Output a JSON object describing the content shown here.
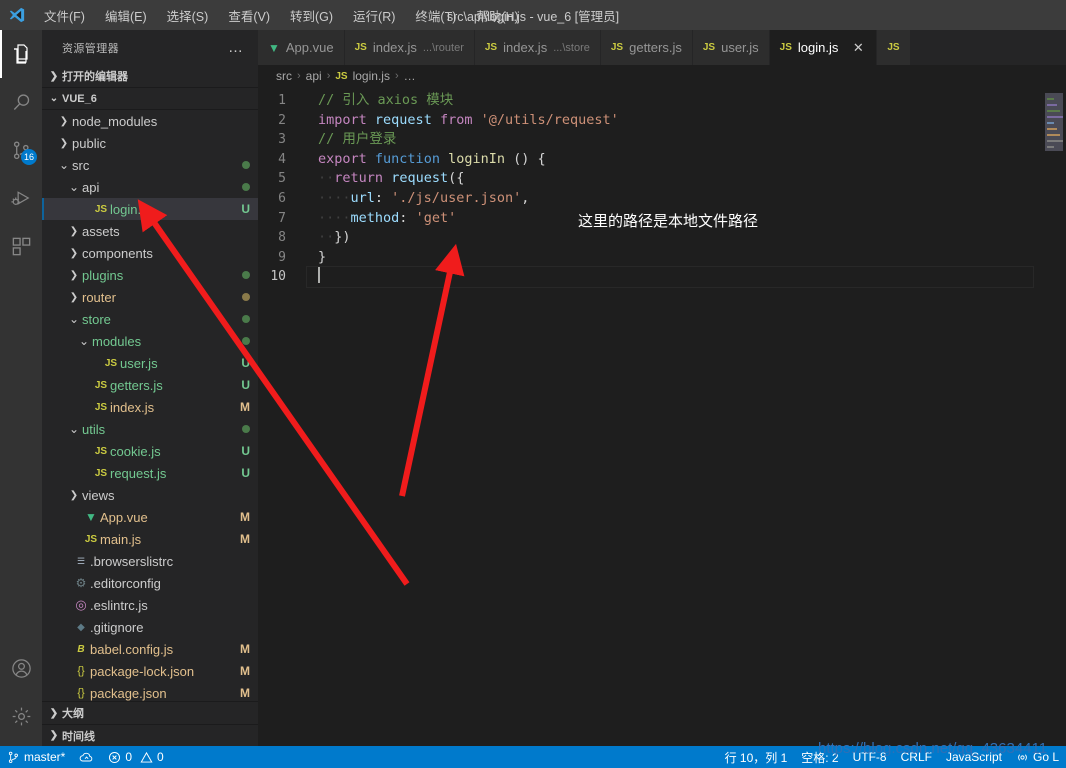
{
  "titlebar": {
    "logo": "vscode-logo-icon",
    "title": "src\\api\\login.js - vue_6 [管理员]",
    "menus": [
      {
        "label": "文件(F)"
      },
      {
        "label": "编辑(E)"
      },
      {
        "label": "选择(S)"
      },
      {
        "label": "查看(V)"
      },
      {
        "label": "转到(G)"
      },
      {
        "label": "运行(R)"
      },
      {
        "label": "终端(T)"
      },
      {
        "label": "帮助(H)"
      }
    ]
  },
  "activitybar": {
    "items": [
      {
        "name": "explorer",
        "icon": "files-icon",
        "active": true,
        "badge": ""
      },
      {
        "name": "search",
        "icon": "search-icon",
        "active": false,
        "badge": ""
      },
      {
        "name": "source-control",
        "icon": "source-control-icon",
        "active": false,
        "badge": "16"
      },
      {
        "name": "run-debug",
        "icon": "run-debug-icon",
        "active": false,
        "badge": ""
      },
      {
        "name": "extensions",
        "icon": "extensions-icon",
        "active": false,
        "badge": ""
      }
    ],
    "bottom": [
      {
        "name": "accounts",
        "icon": "account-icon"
      },
      {
        "name": "settings",
        "icon": "gear-icon"
      }
    ]
  },
  "sidebar": {
    "title": "资源管理器",
    "more_actions": "…",
    "open_editors_label": "打开的编辑器",
    "project_label": "VUE_6",
    "tree": [
      {
        "label": "node_modules",
        "indent": 1,
        "type": "folder",
        "arrow": "right",
        "icon": "",
        "status": "",
        "dot": ""
      },
      {
        "label": "public",
        "indent": 1,
        "type": "folder",
        "arrow": "right",
        "icon": "",
        "status": "",
        "dot": ""
      },
      {
        "label": "src",
        "indent": 1,
        "type": "folder",
        "arrow": "down",
        "icon": "",
        "status": "",
        "dot": "#4a7a4a"
      },
      {
        "label": "api",
        "indent": 2,
        "type": "folder",
        "arrow": "down",
        "icon": "",
        "status": "",
        "dot": "#4a7a4a"
      },
      {
        "label": "login.js",
        "indent": 3,
        "type": "file",
        "arrow": "",
        "icon": "js",
        "status": "U",
        "dot": "",
        "selected": true,
        "color": "#73c991"
      },
      {
        "label": "assets",
        "indent": 2,
        "type": "folder",
        "arrow": "right",
        "icon": "",
        "status": "",
        "dot": ""
      },
      {
        "label": "components",
        "indent": 2,
        "type": "folder",
        "arrow": "right",
        "icon": "",
        "status": "",
        "dot": ""
      },
      {
        "label": "plugins",
        "indent": 2,
        "type": "folder",
        "arrow": "right",
        "icon": "",
        "status": "",
        "dot": "#4a7a4a",
        "color": "#73c991"
      },
      {
        "label": "router",
        "indent": 2,
        "type": "folder",
        "arrow": "right",
        "icon": "",
        "status": "",
        "dot": "#8a7a4a",
        "color": "#e2c08d"
      },
      {
        "label": "store",
        "indent": 2,
        "type": "folder",
        "arrow": "down",
        "icon": "",
        "status": "",
        "dot": "#4a7a4a",
        "color": "#73c991"
      },
      {
        "label": "modules",
        "indent": 3,
        "type": "folder",
        "arrow": "down",
        "icon": "",
        "status": "",
        "dot": "#4a7a4a",
        "color": "#73c991"
      },
      {
        "label": "user.js",
        "indent": 4,
        "type": "file",
        "arrow": "",
        "icon": "js",
        "status": "U",
        "dot": "",
        "color": "#73c991"
      },
      {
        "label": "getters.js",
        "indent": 3,
        "type": "file",
        "arrow": "",
        "icon": "js",
        "status": "U",
        "dot": "",
        "color": "#73c991"
      },
      {
        "label": "index.js",
        "indent": 3,
        "type": "file",
        "arrow": "",
        "icon": "js",
        "status": "M",
        "dot": "",
        "color": "#e2c08d"
      },
      {
        "label": "utils",
        "indent": 2,
        "type": "folder",
        "arrow": "down",
        "icon": "",
        "status": "",
        "dot": "#4a7a4a",
        "color": "#73c991"
      },
      {
        "label": "cookie.js",
        "indent": 3,
        "type": "file",
        "arrow": "",
        "icon": "js",
        "status": "U",
        "dot": "",
        "color": "#73c991"
      },
      {
        "label": "request.js",
        "indent": 3,
        "type": "file",
        "arrow": "",
        "icon": "js",
        "status": "U",
        "dot": "",
        "color": "#73c991"
      },
      {
        "label": "views",
        "indent": 2,
        "type": "folder",
        "arrow": "right",
        "icon": "",
        "status": "",
        "dot": ""
      },
      {
        "label": "App.vue",
        "indent": 2,
        "type": "file",
        "arrow": "",
        "icon": "vue",
        "status": "M",
        "dot": "",
        "color": "#e2c08d"
      },
      {
        "label": "main.js",
        "indent": 2,
        "type": "file",
        "arrow": "",
        "icon": "js",
        "status": "M",
        "dot": "",
        "color": "#e2c08d"
      },
      {
        "label": ".browserslistrc",
        "indent": 1,
        "type": "file",
        "arrow": "",
        "icon": "list",
        "status": "",
        "dot": ""
      },
      {
        "label": ".editorconfig",
        "indent": 1,
        "type": "file",
        "arrow": "",
        "icon": "gear",
        "status": "",
        "dot": ""
      },
      {
        "label": ".eslintrc.js",
        "indent": 1,
        "type": "file",
        "arrow": "",
        "icon": "eslint",
        "status": "",
        "dot": ""
      },
      {
        "label": ".gitignore",
        "indent": 1,
        "type": "file",
        "arrow": "",
        "icon": "diamond",
        "status": "",
        "dot": ""
      },
      {
        "label": "babel.config.js",
        "indent": 1,
        "type": "file",
        "arrow": "",
        "icon": "babel",
        "status": "M",
        "dot": "",
        "color": "#e2c08d"
      },
      {
        "label": "package-lock.json",
        "indent": 1,
        "type": "file",
        "arrow": "",
        "icon": "json",
        "status": "M",
        "dot": "",
        "color": "#e2c08d"
      },
      {
        "label": "package.json",
        "indent": 1,
        "type": "file",
        "arrow": "",
        "icon": "json",
        "status": "M",
        "dot": "",
        "color": "#e2c08d"
      }
    ],
    "outline_label": "大纲",
    "timeline_label": "时间线"
  },
  "tabs": [
    {
      "label": "App.vue",
      "desc": "",
      "icon": "vue",
      "active": false,
      "close": ""
    },
    {
      "label": "index.js",
      "desc": "...\\router",
      "icon": "js",
      "active": false,
      "close": ""
    },
    {
      "label": "index.js",
      "desc": "...\\store",
      "icon": "js",
      "active": false,
      "close": ""
    },
    {
      "label": "getters.js",
      "desc": "",
      "icon": "js",
      "active": false,
      "close": ""
    },
    {
      "label": "user.js",
      "desc": "",
      "icon": "js",
      "active": false,
      "close": ""
    },
    {
      "label": "login.js",
      "desc": "",
      "icon": "js",
      "active": true,
      "close": "✕"
    },
    {
      "label": "",
      "desc": "",
      "icon": "js",
      "active": false,
      "close": ""
    }
  ],
  "breadcrumb": {
    "parts": [
      "src",
      "api",
      "login.js",
      "…"
    ],
    "separator": "›",
    "file_icon": "js"
  },
  "editor": {
    "lines": [
      {
        "num": "1",
        "segments": [
          {
            "t": "// 引入 axios 模块",
            "c": "cm"
          }
        ]
      },
      {
        "num": "2",
        "segments": [
          {
            "t": "import",
            "c": "kw"
          },
          {
            "t": " ",
            "c": "pl"
          },
          {
            "t": "request",
            "c": "id"
          },
          {
            "t": " ",
            "c": "pl"
          },
          {
            "t": "from",
            "c": "kw"
          },
          {
            "t": " ",
            "c": "pl"
          },
          {
            "t": "'@/utils/request'",
            "c": "st"
          }
        ]
      },
      {
        "num": "3",
        "segments": [
          {
            "t": "// 用户登录",
            "c": "cm"
          }
        ]
      },
      {
        "num": "4",
        "segments": [
          {
            "t": "export",
            "c": "kw"
          },
          {
            "t": " ",
            "c": "pl"
          },
          {
            "t": "function",
            "c": "kw2"
          },
          {
            "t": " ",
            "c": "pl"
          },
          {
            "t": "loginIn",
            "c": "fn"
          },
          {
            "t": " () {",
            "c": "pl"
          }
        ]
      },
      {
        "num": "5",
        "segments": [
          {
            "t": "··",
            "c": "ig"
          },
          {
            "t": "return",
            "c": "kw"
          },
          {
            "t": " ",
            "c": "pl"
          },
          {
            "t": "request",
            "c": "id"
          },
          {
            "t": "({",
            "c": "pl"
          }
        ]
      },
      {
        "num": "6",
        "segments": [
          {
            "t": "····",
            "c": "ig"
          },
          {
            "t": "url",
            "c": "id"
          },
          {
            "t": ": ",
            "c": "pl"
          },
          {
            "t": "'./js/user.json'",
            "c": "st"
          },
          {
            "t": ",",
            "c": "pl"
          }
        ]
      },
      {
        "num": "7",
        "segments": [
          {
            "t": "····",
            "c": "ig"
          },
          {
            "t": "method",
            "c": "id"
          },
          {
            "t": ": ",
            "c": "pl"
          },
          {
            "t": "'get'",
            "c": "st"
          }
        ]
      },
      {
        "num": "8",
        "segments": [
          {
            "t": "··",
            "c": "ig"
          },
          {
            "t": "})",
            "c": "pl"
          }
        ]
      },
      {
        "num": "9",
        "segments": [
          {
            "t": "}",
            "c": "pl"
          }
        ]
      },
      {
        "num": "10",
        "segments": [],
        "current": true,
        "cursor": true
      }
    ],
    "annotation": "这里的路径是本地文件路径"
  },
  "statusbar": {
    "left": [
      {
        "name": "branch",
        "icon": "git-branch-icon",
        "label": "master*"
      },
      {
        "name": "sync",
        "icon": "sync-cloud-icon",
        "label": ""
      },
      {
        "name": "problems",
        "icon": "error-warning-icon",
        "label": "0 0",
        "errors": "0",
        "warnings": "0"
      }
    ],
    "right": [
      {
        "name": "cursor-position",
        "label": "行 10，列 1"
      },
      {
        "name": "indentation",
        "label": "空格: 2"
      },
      {
        "name": "encoding",
        "label": "UTF-8"
      },
      {
        "name": "eol",
        "label": "CRLF"
      },
      {
        "name": "language-mode",
        "label": "JavaScript"
      },
      {
        "name": "go-live",
        "label": "Go L",
        "icon": "broadcast-icon"
      }
    ]
  },
  "watermark": "https://blog.csdn.net/qq_43634411",
  "colors": {
    "accent": "#007acc",
    "annotation_arrow": "#f01c1c",
    "modified": "#e2c08d",
    "untracked": "#73c991"
  }
}
